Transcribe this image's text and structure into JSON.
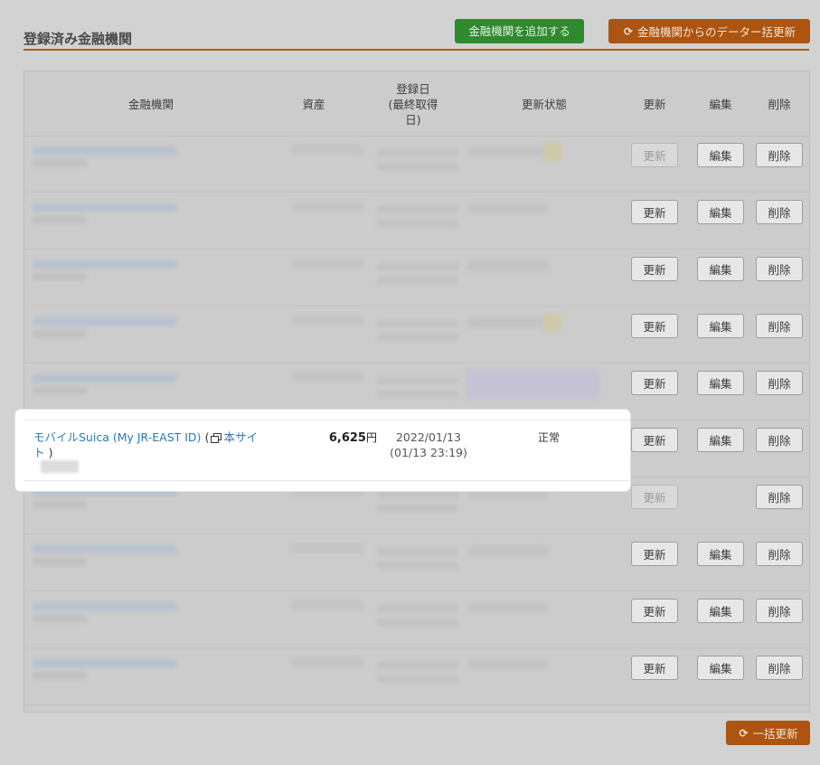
{
  "section": {
    "title": "登録済み金融機関",
    "add_button": "金融機関を追加する",
    "bulk_update_all_button": "金融機関からのデーター括更新"
  },
  "table": {
    "headers": {
      "institution": "金融機関",
      "assets": "資産",
      "registered": "登録日\n(最終取得\n日)",
      "status": "更新状態",
      "update": "更新",
      "edit": "編集",
      "delete": "削除"
    },
    "row_button_labels": {
      "update": "更新",
      "edit": "編集",
      "delete": "削除"
    },
    "highlighted_row": {
      "institution_name": "モバイルSuica (My JR-EAST ID)",
      "open_paren": "(",
      "site_link": "本サイト",
      "close_paren": ")",
      "amount": "6,625",
      "currency": "円",
      "registered_date": "2022/01/13",
      "last_fetched": "(01/13 23:19)",
      "status": "正常"
    }
  },
  "footer": {
    "bulk_update_button": "一括更新"
  },
  "icons": {
    "refresh": "refresh-icon",
    "external_window": "external-window-icon"
  },
  "colors": {
    "green_button": "#2d8a2d",
    "orange_button": "#ac5410",
    "title_rule": "#a4621b",
    "link": "#2a7ab8"
  }
}
